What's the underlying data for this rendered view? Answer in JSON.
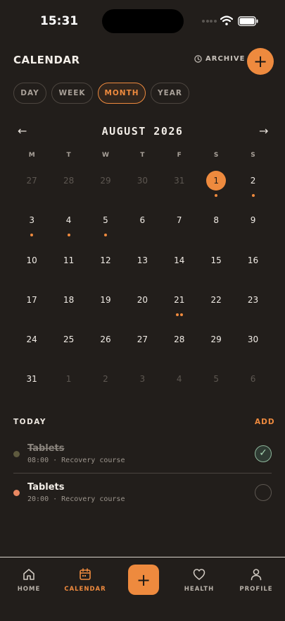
{
  "status_bar": {
    "time": "15:31"
  },
  "header": {
    "title": "CALENDAR",
    "archive_label": "ARCHIVE",
    "add_label": "+"
  },
  "segments": [
    {
      "label": "DAY",
      "active": false
    },
    {
      "label": "WEEK",
      "active": false
    },
    {
      "label": "MONTH",
      "active": true
    },
    {
      "label": "YEAR",
      "active": false
    }
  ],
  "month_nav": {
    "prev": "←",
    "label": "AUGUST 2026",
    "next": "→"
  },
  "weekdays": [
    "M",
    "T",
    "W",
    "T",
    "F",
    "S",
    "S"
  ],
  "days": [
    {
      "n": "27",
      "muted": true,
      "dots": 0
    },
    {
      "n": "28",
      "muted": true,
      "dots": 0
    },
    {
      "n": "29",
      "muted": true,
      "dots": 0
    },
    {
      "n": "30",
      "muted": true,
      "dots": 0
    },
    {
      "n": "31",
      "muted": true,
      "dots": 0
    },
    {
      "n": "1",
      "muted": false,
      "dots": 1,
      "selected": true
    },
    {
      "n": "2",
      "muted": false,
      "dots": 1
    },
    {
      "n": "3",
      "muted": false,
      "dots": 1
    },
    {
      "n": "4",
      "muted": false,
      "dots": 1
    },
    {
      "n": "5",
      "muted": false,
      "dots": 1
    },
    {
      "n": "6",
      "muted": false,
      "dots": 0
    },
    {
      "n": "7",
      "muted": false,
      "dots": 0
    },
    {
      "n": "8",
      "muted": false,
      "dots": 0
    },
    {
      "n": "9",
      "muted": false,
      "dots": 0
    },
    {
      "n": "10",
      "muted": false,
      "dots": 0
    },
    {
      "n": "11",
      "muted": false,
      "dots": 0
    },
    {
      "n": "12",
      "muted": false,
      "dots": 0
    },
    {
      "n": "13",
      "muted": false,
      "dots": 0
    },
    {
      "n": "14",
      "muted": false,
      "dots": 0
    },
    {
      "n": "15",
      "muted": false,
      "dots": 0
    },
    {
      "n": "16",
      "muted": false,
      "dots": 0
    },
    {
      "n": "17",
      "muted": false,
      "dots": 0
    },
    {
      "n": "18",
      "muted": false,
      "dots": 0
    },
    {
      "n": "19",
      "muted": false,
      "dots": 0
    },
    {
      "n": "20",
      "muted": false,
      "dots": 0
    },
    {
      "n": "21",
      "muted": false,
      "dots": 2
    },
    {
      "n": "22",
      "muted": false,
      "dots": 0
    },
    {
      "n": "23",
      "muted": false,
      "dots": 0
    },
    {
      "n": "24",
      "muted": false,
      "dots": 0
    },
    {
      "n": "25",
      "muted": false,
      "dots": 0
    },
    {
      "n": "26",
      "muted": false,
      "dots": 0
    },
    {
      "n": "27",
      "muted": false,
      "dots": 0
    },
    {
      "n": "28",
      "muted": false,
      "dots": 0
    },
    {
      "n": "29",
      "muted": false,
      "dots": 0
    },
    {
      "n": "30",
      "muted": false,
      "dots": 0
    },
    {
      "n": "31",
      "muted": false,
      "dots": 0
    },
    {
      "n": "1",
      "muted": true,
      "dots": 0
    },
    {
      "n": "2",
      "muted": true,
      "dots": 0
    },
    {
      "n": "3",
      "muted": true,
      "dots": 0
    },
    {
      "n": "4",
      "muted": true,
      "dots": 0
    },
    {
      "n": "5",
      "muted": true,
      "dots": 0
    },
    {
      "n": "6",
      "muted": true,
      "dots": 0
    }
  ],
  "today": {
    "label": "TODAY",
    "add_label": "ADD",
    "tasks": [
      {
        "title": "Tablets",
        "subtitle": "08:00 · Recovery course",
        "done": true
      },
      {
        "title": "Tablets",
        "subtitle": "20:00 · Recovery course",
        "done": false
      }
    ]
  },
  "tab_bar": {
    "home": "HOME",
    "calendar": "CALENDAR",
    "fab": "+",
    "health": "HEALTH",
    "profile": "PROFILE",
    "active": "calendar"
  },
  "colors": {
    "accent": "#ee8a3e",
    "background": "#221e1b",
    "done_check": "#8db59a"
  }
}
